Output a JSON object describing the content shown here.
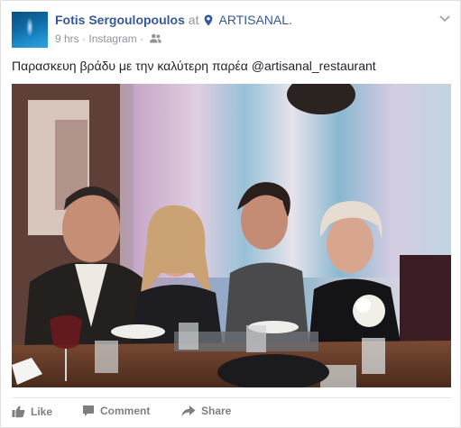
{
  "post": {
    "author": "Fotis Sergoulopoulos",
    "at": "at",
    "place": "ARTISANAL.",
    "time": "9 hrs",
    "source": "Instagram",
    "separator": "·",
    "text": "Παρασκευη βράδυ με την καλύτερη παρέα @artisanal_restaurant"
  },
  "actions": {
    "like": "Like",
    "comment": "Comment",
    "share": "Share"
  },
  "colors": {
    "link": "#365899",
    "meta": "#90949c",
    "action": "#7f7f7f"
  },
  "icons": [
    "location-pin-icon",
    "friends-audience-icon",
    "chevron-down-icon",
    "thumbs-up-icon",
    "comment-icon",
    "share-arrow-icon"
  ]
}
